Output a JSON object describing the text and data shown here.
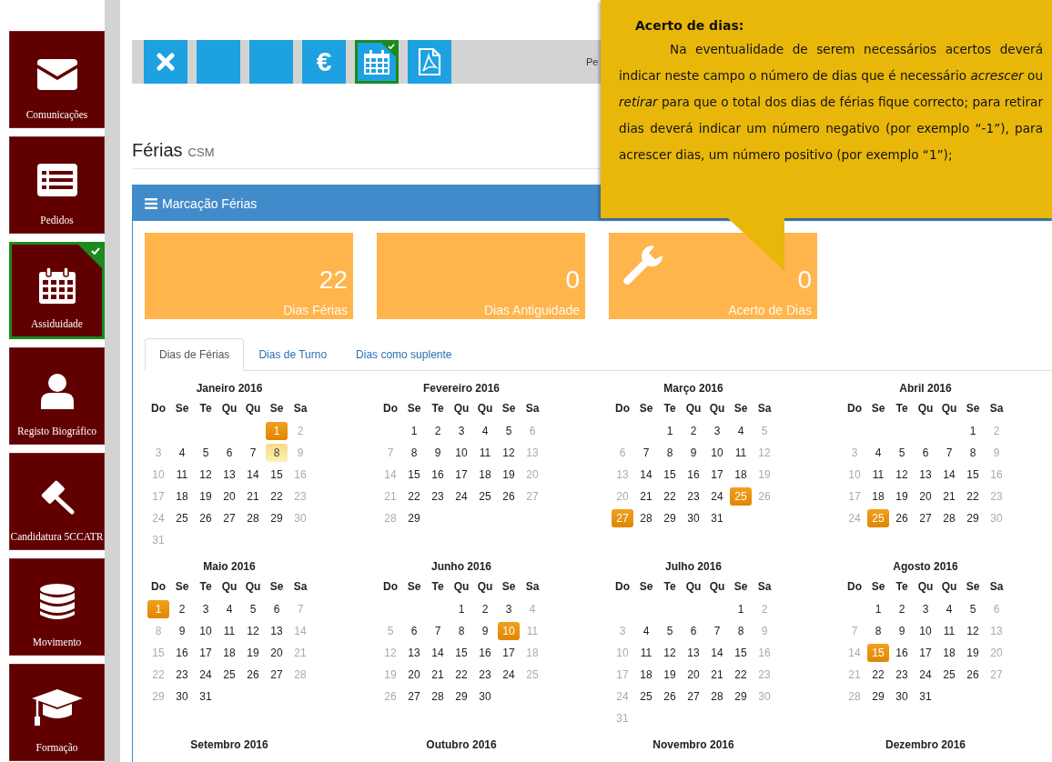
{
  "sidebar": {
    "items": [
      {
        "label": "Comunicações",
        "kind": "envelope",
        "selected": false
      },
      {
        "label": "Pedidos",
        "kind": "list",
        "selected": false
      },
      {
        "label": "Assiduidade",
        "kind": "calendar",
        "selected": true
      },
      {
        "label": "Registo Biográfico",
        "kind": "person",
        "selected": false
      },
      {
        "label": "Candidatura 5CCATR",
        "kind": "gavel",
        "selected": false
      },
      {
        "label": "Movimento",
        "kind": "database",
        "selected": false
      },
      {
        "label": "Formação",
        "kind": "cap",
        "selected": false
      }
    ]
  },
  "toolbar": {
    "buttons": [
      {
        "kind": "close",
        "selected": false
      },
      {
        "kind": "blank",
        "selected": false
      },
      {
        "kind": "blank",
        "selected": false
      },
      {
        "kind": "euro",
        "label": "€",
        "selected": false
      },
      {
        "kind": "calendar",
        "selected": true
      },
      {
        "kind": "pdf",
        "selected": false
      }
    ],
    "user_name": "Pe"
  },
  "page": {
    "title": "Férias",
    "subtitle": "CSM"
  },
  "panel": {
    "title": "Marcação Férias",
    "stats": [
      {
        "value": "22",
        "label": "Dias Férias",
        "kind": "plain"
      },
      {
        "value": "0",
        "label": "Dias Antiguidade",
        "kind": "plain"
      },
      {
        "value": "0",
        "label": "Acerto de Dias",
        "kind": "wrench"
      }
    ],
    "tabs": [
      {
        "label": "Dias de Férias",
        "selected": true
      },
      {
        "label": "Dias de Turno",
        "selected": false
      },
      {
        "label": "Dias como suplente",
        "selected": false
      }
    ],
    "months": [
      {
        "title": "Janeiro 2016",
        "weekdays": [
          "Do",
          "Se",
          "Te",
          "Qu",
          "Qu",
          "Se",
          "Sa"
        ],
        "weeks": [
          [
            {
              "day": "1",
              "kind": "booked"
            },
            "2"
          ],
          [
            "3",
            "4",
            "5",
            "6",
            "7",
            {
              "day": "8",
              "kind": "pending"
            },
            "9"
          ],
          [
            "10",
            "11",
            "12",
            "13",
            "14",
            "15",
            "16"
          ],
          [
            "17",
            "18",
            "19",
            "20",
            "21",
            "22",
            "23"
          ],
          [
            "24",
            "25",
            "26",
            "27",
            "28",
            "29",
            "30"
          ],
          [
            "31"
          ]
        ]
      },
      {
        "title": "Fevereiro 2016",
        "weekdays": [
          "Do",
          "Se",
          "Te",
          "Qu",
          "Qu",
          "Se",
          "Sa"
        ],
        "weeks": [
          [
            "1",
            "2",
            "3",
            "4",
            "5",
            "6"
          ],
          [
            "7",
            "8",
            "9",
            "10",
            "11",
            "12",
            "13"
          ],
          [
            "14",
            "15",
            "16",
            "17",
            "18",
            "19",
            "20"
          ],
          [
            "21",
            "22",
            "23",
            "24",
            "25",
            "26",
            "27"
          ],
          [
            "28",
            "29"
          ]
        ]
      },
      {
        "title": "Março 2016",
        "weekdays": [
          "Do",
          "Se",
          "Te",
          "Qu",
          "Qu",
          "Se",
          "Sa"
        ],
        "weeks": [
          [
            "1",
            "2",
            "3",
            "4",
            "5"
          ],
          [
            "6",
            "7",
            "8",
            "9",
            "10",
            "11",
            "12"
          ],
          [
            "13",
            "14",
            "15",
            "16",
            "17",
            "18",
            "19"
          ],
          [
            "20",
            "21",
            "22",
            "23",
            "24",
            {
              "day": "25",
              "kind": "booked"
            },
            "26"
          ],
          [
            {
              "day": "27",
              "kind": "booked"
            },
            "28",
            "29",
            "30",
            "31"
          ]
        ]
      },
      {
        "title": "Abril 2016",
        "weekdays": [
          "Do",
          "Se",
          "Te",
          "Qu",
          "Qu",
          "Se",
          "Sa"
        ],
        "weeks": [
          [
            "1",
            "2"
          ],
          [
            "3",
            "4",
            "5",
            "6",
            "7",
            "8",
            "9"
          ],
          [
            "10",
            "11",
            "12",
            "13",
            "14",
            "15",
            "16"
          ],
          [
            "17",
            "18",
            "19",
            "20",
            "21",
            "22",
            "23"
          ],
          [
            "24",
            {
              "day": "25",
              "kind": "booked"
            },
            "26",
            "27",
            "28",
            "29",
            "30"
          ]
        ]
      },
      {
        "title": "Maio 2016",
        "weekdays": [
          "Do",
          "Se",
          "Te",
          "Qu",
          "Qu",
          "Se",
          "Sa"
        ],
        "weeks": [
          [
            {
              "day": "1",
              "kind": "booked"
            },
            "2",
            "3",
            "4",
            "5",
            "6",
            "7"
          ],
          [
            "8",
            "9",
            "10",
            "11",
            "12",
            "13",
            "14"
          ],
          [
            "15",
            "16",
            "17",
            "18",
            "19",
            "20",
            "21"
          ],
          [
            "22",
            "23",
            "24",
            "25",
            "26",
            "27",
            "28"
          ],
          [
            "29",
            "30",
            "31"
          ]
        ]
      },
      {
        "title": "Junho 2016",
        "weekdays": [
          "Do",
          "Se",
          "Te",
          "Qu",
          "Qu",
          "Se",
          "Sa"
        ],
        "weeks": [
          [
            "1",
            "2",
            "3",
            "4"
          ],
          [
            "5",
            "6",
            "7",
            "8",
            "9",
            {
              "day": "10",
              "kind": "booked"
            },
            "11"
          ],
          [
            "12",
            "13",
            "14",
            "15",
            "16",
            "17",
            "18"
          ],
          [
            "19",
            "20",
            "21",
            "22",
            "23",
            "24",
            "25"
          ],
          [
            "26",
            "27",
            "28",
            "29",
            "30"
          ]
        ]
      },
      {
        "title": "Julho 2016",
        "weekdays": [
          "Do",
          "Se",
          "Te",
          "Qu",
          "Qu",
          "Se",
          "Sa"
        ],
        "weeks": [
          [
            "1",
            "2"
          ],
          [
            "3",
            "4",
            "5",
            "6",
            "7",
            "8",
            "9"
          ],
          [
            "10",
            "11",
            "12",
            "13",
            "14",
            "15",
            "16"
          ],
          [
            "17",
            "18",
            "19",
            "20",
            "21",
            "22",
            "23"
          ],
          [
            "24",
            "25",
            "26",
            "27",
            "28",
            "29",
            "30"
          ],
          [
            "31"
          ]
        ]
      },
      {
        "title": "Agosto 2016",
        "weekdays": [
          "Do",
          "Se",
          "Te",
          "Qu",
          "Qu",
          "Se",
          "Sa"
        ],
        "weeks": [
          [
            "1",
            "2",
            "3",
            "4",
            "5",
            "6"
          ],
          [
            "7",
            "8",
            "9",
            "10",
            "11",
            "12",
            "13"
          ],
          [
            "14",
            {
              "day": "15",
              "kind": "booked"
            },
            "16",
            "17",
            "18",
            "19",
            "20"
          ],
          [
            "21",
            "22",
            "23",
            "24",
            "25",
            "26",
            "27"
          ],
          [
            "28",
            "29",
            "30",
            "31"
          ]
        ]
      },
      {
        "title": "Setembro 2016"
      },
      {
        "title": "Outubro 2016"
      },
      {
        "title": "Novembro 2016"
      },
      {
        "title": "Dezembro 2016"
      }
    ]
  },
  "callout": {
    "title": "Acerto de dias:",
    "text": "Na eventualidade de serem necessários acertos deverá indicar neste campo o número de dias que é necessário *acrescer* ou *retirar* para que o total dos dias de férias fique correcto; para retirar dias deverá indicar um número negativo (por exemplo “-1”), para acrescer dias, um número positivo (por exemplo “1”);"
  }
}
